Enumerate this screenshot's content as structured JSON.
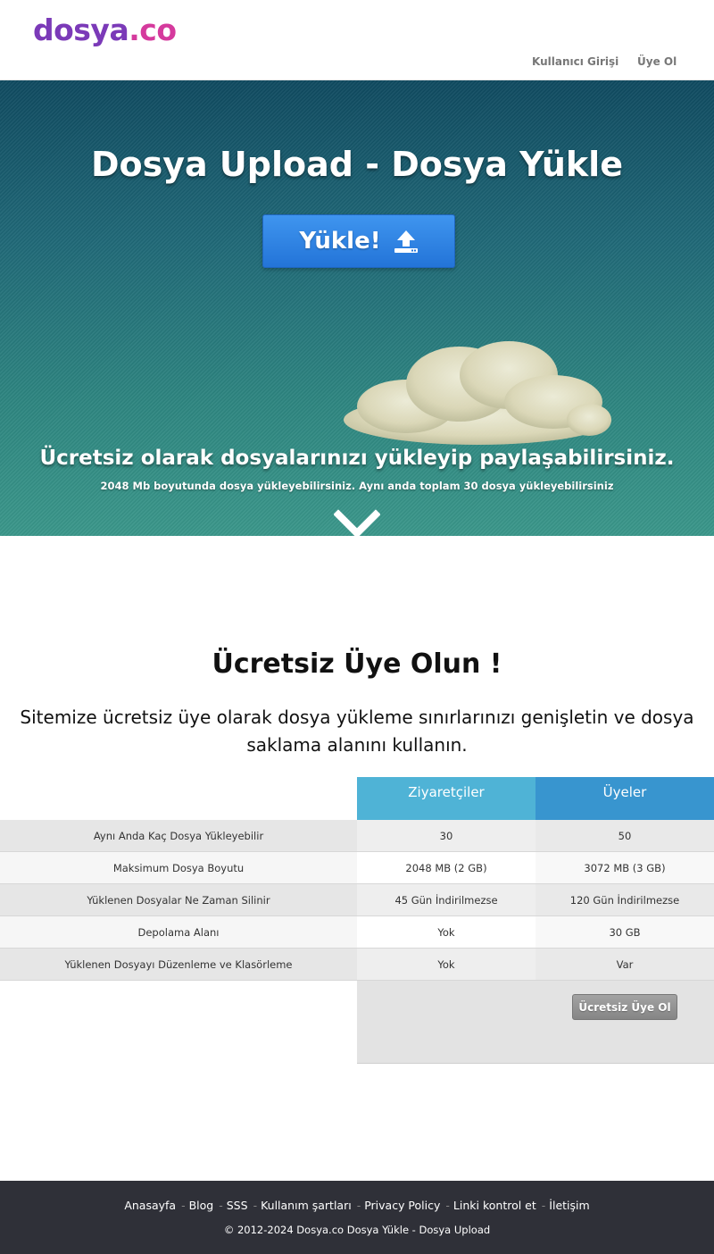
{
  "header": {
    "logo_part1": "dosya",
    "logo_part2": ".co",
    "nav_login": "Kullanıcı Girişi",
    "nav_register": "Üye Ol"
  },
  "hero": {
    "title": "Dosya Upload - Dosya Yükle",
    "upload_button": "Yükle!",
    "subtitle": "Ücretsiz olarak dosyalarınızı yükleyip paylaşabilirsiniz.",
    "note": "2048 Mb boyutunda dosya yükleyebilirsiniz. Aynı anda toplam 30 dosya yükleyebilirsiniz"
  },
  "membership": {
    "title": "Ücretsiz Üye Olun !",
    "description": "Sitemize ücretsiz üye olarak dosya yükleme sınırlarınızı genişletin ve dosya saklama alanını kullanın.",
    "columns": [
      "Ziyaretçiler",
      "Üyeler"
    ],
    "rows": [
      {
        "label": "Aynı Anda Kaç Dosya Yükleyebilir",
        "visitors": "30",
        "members": "50"
      },
      {
        "label": "Maksimum Dosya Boyutu",
        "visitors": "2048 MB (2 GB)",
        "members": "3072 MB (3 GB)"
      },
      {
        "label": "Yüklenen Dosyalar Ne Zaman Silinir",
        "visitors": "45 Gün İndirilmezse",
        "members": "120 Gün İndirilmezse"
      },
      {
        "label": "Depolama Alanı",
        "visitors": "Yok",
        "members": "30 GB"
      },
      {
        "label": "Yüklenen Dosyayı Düzenleme ve Klasörleme",
        "visitors": "Yok",
        "members": "Var"
      }
    ],
    "signup_button": "Ücretsiz Üye Ol"
  },
  "footer": {
    "links": [
      "Anasayfa",
      "Blog",
      "SSS",
      "Kullanım şartları",
      "Privacy Policy",
      "Linki kontrol et",
      "İletişim"
    ],
    "copyright": "© 2012-2024 Dosya.co Dosya Yükle - Dosya Upload"
  },
  "colors": {
    "brand_purple": "#7b3ab8",
    "brand_pink": "#d53a9d",
    "upload_blue": "#2f86e6",
    "visitors_header": "#4fb3d6",
    "members_header": "#3895cf",
    "footer_bg": "#2f3038"
  },
  "icons": [
    "upload-icon",
    "chevron-down-icon",
    "cloud-image"
  ]
}
